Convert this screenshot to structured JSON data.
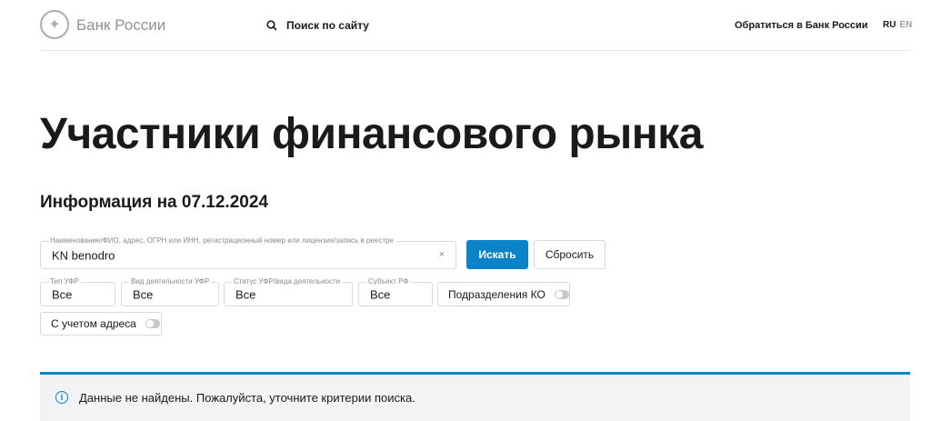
{
  "header": {
    "logo_text": "Банк России",
    "search_label": "Поиск по сайту",
    "contact_label": "Обратиться в Банк России",
    "lang_ru": "RU",
    "lang_en": "EN"
  },
  "page": {
    "title": "Участники финансового рынка",
    "subtitle": "Информация на 07.12.2024"
  },
  "search": {
    "label": "Наименование/ФИО, адрес, ОГРН или ИНН, регистрационный номер или лицензия/запись в реестре",
    "value": "KN benodro",
    "clear": "×",
    "submit": "Искать",
    "reset": "Сбросить"
  },
  "filters": [
    {
      "label": "Тип УФР",
      "value": "Все"
    },
    {
      "label": "Вид деятельности УФР",
      "value": "Все"
    },
    {
      "label": "Статус УФР/вида деятельности",
      "value": "Все"
    },
    {
      "label": "Субъект РФ",
      "value": "Все"
    }
  ],
  "toggles": {
    "branches": "Подразделения КО",
    "address": "С учетом адреса"
  },
  "alert": {
    "icon": "i",
    "text": "Данные не найдены. Пожалуйста, уточните критерии поиска."
  },
  "colors": {
    "accent": "#0a83c8"
  }
}
